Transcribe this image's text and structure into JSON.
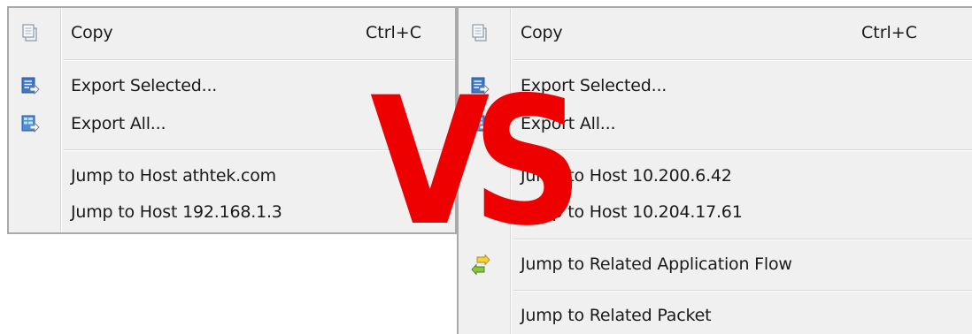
{
  "left_menu": {
    "copy": {
      "label": "Copy",
      "shortcut": "Ctrl+C",
      "icon": "copy-icon"
    },
    "export_selected": {
      "label": "Export Selected...",
      "icon": "export-selected-icon"
    },
    "export_all": {
      "label": "Export All...",
      "icon": "export-all-icon"
    },
    "jump_host_1": {
      "label": "Jump to Host athtek.com"
    },
    "jump_host_2": {
      "label": "Jump to Host 192.168.1.3"
    }
  },
  "right_menu": {
    "copy": {
      "label": "Copy",
      "shortcut": "Ctrl+C",
      "icon": "copy-icon"
    },
    "export_selected": {
      "label": "Export Selected...",
      "icon": "export-selected-icon"
    },
    "export_all": {
      "label": "Export All...",
      "icon": "export-all-icon"
    },
    "jump_host_1": {
      "label": "Jump to Host 10.200.6.42"
    },
    "jump_host_2": {
      "label": "Jump to Host 10.204.17.61"
    },
    "jump_flow": {
      "label": "Jump to Related Application Flow",
      "icon": "flow-arrows-icon"
    },
    "jump_packet": {
      "label": "Jump to Related Packet"
    }
  },
  "overlay": {
    "text": "VS",
    "color": "#ee0000"
  },
  "colors": {
    "menu_bg": "#f0f0f0",
    "menu_border": "#a9a9a9",
    "separator": "#d7d7d7"
  }
}
